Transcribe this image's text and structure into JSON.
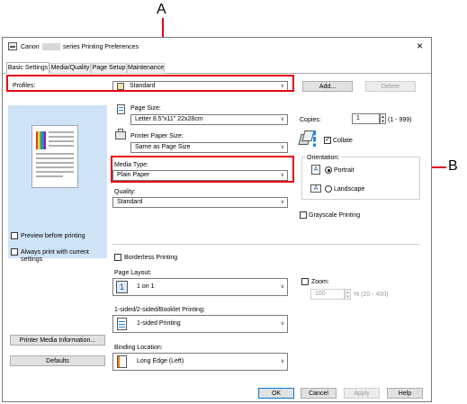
{
  "callouts": {
    "a": "A",
    "b": "B"
  },
  "window": {
    "title_prefix": "Canon",
    "title_suffix": "series Printing Preferences",
    "close_glyph": "×"
  },
  "tabs": [
    {
      "label": "Basic Settings",
      "active": true
    },
    {
      "label": "Media/Quality",
      "active": false
    },
    {
      "label": "Page Setup",
      "active": false
    },
    {
      "label": "Maintenance",
      "active": false
    }
  ],
  "profiles": {
    "label": "Profiles:",
    "value": "Standard",
    "add_button": "Add...",
    "delete_button": "Delete"
  },
  "page_size": {
    "label": "Page Size:",
    "value": "Letter 8.5\"x11\" 22x28cm"
  },
  "printer_paper_size": {
    "label": "Printer Paper Size:",
    "value": "Same as Page Size"
  },
  "media_type": {
    "label": "Media Type:",
    "value": "Plain Paper"
  },
  "quality": {
    "label": "Quality:",
    "value": "Standard"
  },
  "copies": {
    "label": "Copies:",
    "value": "1",
    "range": "(1 - 999)"
  },
  "collate": {
    "label": "Collate",
    "checked": true
  },
  "orientation": {
    "label": "Orientation:",
    "options": [
      {
        "label": "Portrait",
        "selected": true
      },
      {
        "label": "Landscape",
        "selected": false
      }
    ],
    "icon_letter": "A"
  },
  "grayscale": {
    "label": "Grayscale Printing",
    "checked": false
  },
  "preview_before_printing": {
    "label": "Preview before printing",
    "checked": false
  },
  "always_print": {
    "label_line1": "Always print with current",
    "label_line2": "settings",
    "checked": false
  },
  "borderless": {
    "label": "Borderless Printing",
    "checked": false
  },
  "page_layout": {
    "label": "Page Layout:",
    "value": "1 on 1",
    "icon_text": "1"
  },
  "zoom": {
    "label": "Zoom:",
    "value": "100",
    "unit_range": "% (20 - 400)",
    "checked": false
  },
  "duplex": {
    "label": "1-sided/2-sided/Booklet Printing:",
    "value": "1-sided Printing"
  },
  "binding": {
    "label": "Binding Location:",
    "value": "Long Edge (Left)"
  },
  "buttons": {
    "printer_media_info": "Printer Media Information...",
    "defaults": "Defaults",
    "ok": "OK",
    "cancel": "Cancel",
    "apply": "Apply",
    "help": "Help"
  },
  "colors": {
    "callout_red": "#e60012",
    "preview_bg": "#cfe3f7",
    "accent": "#0078d7"
  }
}
